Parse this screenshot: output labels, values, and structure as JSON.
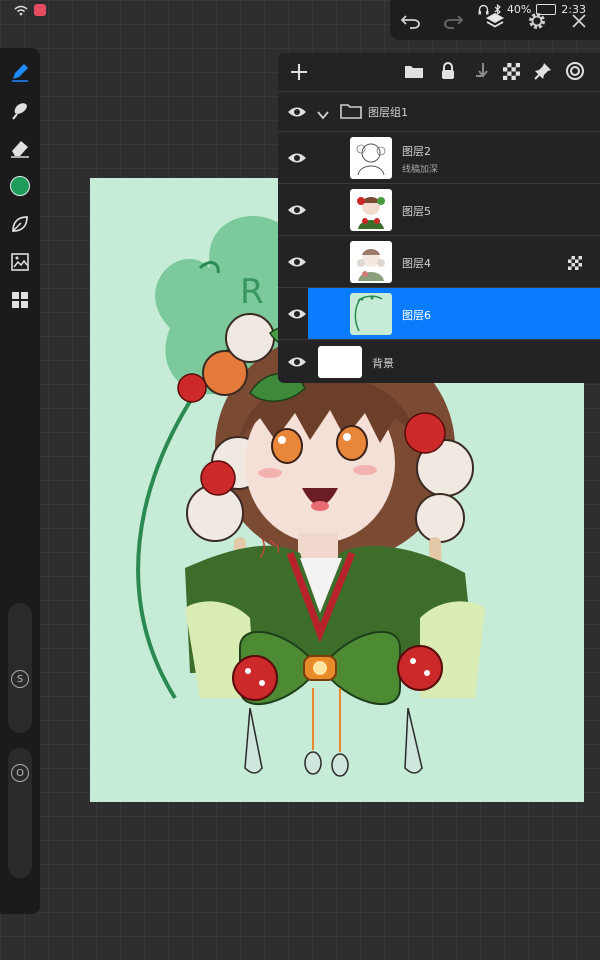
{
  "status": {
    "battery": "40%",
    "time": "2:33"
  },
  "toolbar": {
    "undo_icon": "undo-icon",
    "redo_icon": "redo-icon",
    "layers_icon": "layers-icon",
    "settings_icon": "gear-icon",
    "close_icon": "close-icon"
  },
  "tools": {
    "brush_color": "#1e9c5a",
    "size_label": "S",
    "opacity_label": "O"
  },
  "layers_panel": {
    "accent": "#0a7cff",
    "group": {
      "name": "图层组1"
    },
    "layers": [
      {
        "name": "图层2",
        "subtitle": "线稿加深"
      },
      {
        "name": "图层5",
        "subtitle": ""
      },
      {
        "name": "图层4",
        "subtitle": ""
      },
      {
        "name": "图层6",
        "subtitle": ""
      }
    ],
    "background": {
      "name": "背景"
    }
  }
}
